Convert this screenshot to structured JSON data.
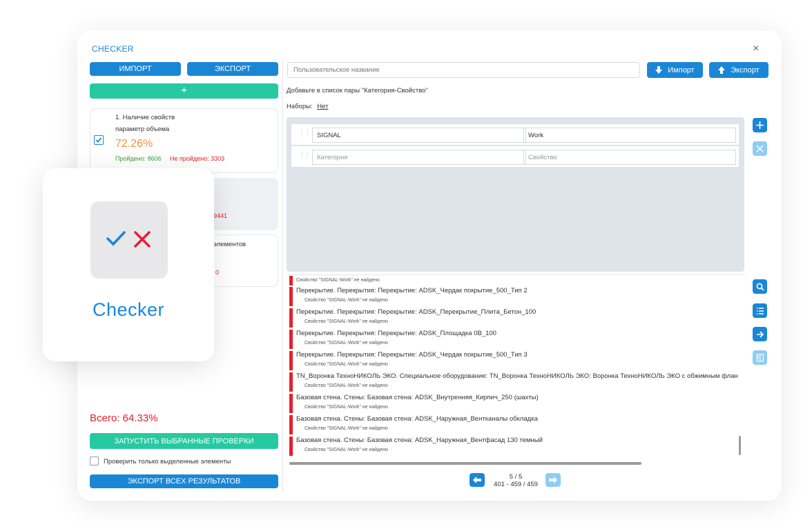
{
  "app": {
    "title": "CHECKER",
    "close": "×"
  },
  "left": {
    "import_label": "ИМПОРТ",
    "export_label": "ЭКСПОРТ",
    "add_label": "+",
    "check1": {
      "title_line1": "1. Наличие свойств",
      "title_line2": "параметр объема",
      "percent": "72.26%",
      "passed": "Пройдено: 8606",
      "failed": "Не пройдено: 3303",
      "checked": true
    },
    "check2": {
      "failed_tail": "9441"
    },
    "check3": {
      "title_tail": "элементов",
      "failed_tail": ": 0"
    },
    "total": "Всего: 64.33%",
    "run_label": "ЗАПУСТИТЬ ВЫБРАННЫЕ ПРОВЕРКИ",
    "only_selected_label": "Проверить только выделенные элементы",
    "export_all_label": "ЭКСПОРТ ВСЕХ РЕЗУЛЬТАТОВ"
  },
  "right": {
    "name_placeholder": "Пользовательское название",
    "import_label": "Импорт",
    "export_label": "Экспорт",
    "hint": "Добавьте в список пары \"Категория-Свойство\"",
    "sets_label": "Наборы:",
    "sets_value": "Нет",
    "pairs": [
      {
        "category": "SIGNAL",
        "property": "Work"
      }
    ],
    "new_pair": {
      "category_placeholder": "Категория",
      "property_placeholder": "Свойство"
    },
    "results_top_sub": "Свойство \"SIGNAL-Work\" не найдено",
    "results": [
      {
        "main": "Перекрытие. Перекрытия: Перекрытие: ADSK_Чердак покрытие_500_Тип 2",
        "sub": "Свойство \"SIGNAL-Work\" не найдено"
      },
      {
        "main": "Перекрытие. Перекрытия: Перекрытие: ADSK_Перекрытие_Плита_Бетон_100",
        "sub": "Свойство \"SIGNAL-Work\" не найдено"
      },
      {
        "main": "Перекрытие. Перекрытия: Перекрытие: ADSK_Площадка 0В_100",
        "sub": "Свойство \"SIGNAL-Work\" не найдено"
      },
      {
        "main": "Перекрытие. Перекрытия: Перекрытие: ADSK_Чердак покрытие_500_Тип 3",
        "sub": "Свойство \"SIGNAL-Work\" не найдено"
      },
      {
        "main": "TN_Воронка ТехноНИКОЛЬ ЭКО. Специальное оборудование: TN_Воронка ТехноНИКОЛЬ ЭКО: Воронка ТехноНИКОЛЬ ЭКО с обжимным флан",
        "sub": "Свойство \"SIGNAL-Work\" не найдено"
      },
      {
        "main": "Базовая стена. Стены: Базовая стена: ADSK_Внутренняя_Кирпич_250 (шахты)",
        "sub": "Свойство \"SIGNAL-Work\" не найдено"
      },
      {
        "main": "Базовая стена. Стены: Базовая стена: ADSK_Наружная_Вентканалы обкладка",
        "sub": "Свойство \"SIGNAL-Work\" не найдено"
      },
      {
        "main": "Базовая стена. Стены: Базовая стена: ADSK_Наружная_Вентфасад 130 темный",
        "sub": "Свойство \"SIGNAL-Work\" не найдено"
      }
    ],
    "pager": {
      "page": "5 / 5",
      "range": "401 - 459 / 459"
    }
  },
  "overlay": {
    "brand": "Checker"
  },
  "colors": {
    "accent_blue": "#1a87d6",
    "accent_green": "#26c9a1",
    "error_red": "#e5202a",
    "percent_orange": "#f5913a"
  },
  "icons": [
    "plus-icon",
    "close-icon",
    "search-icon",
    "list-icon",
    "arrow-right-icon",
    "columns-icon",
    "arrow-left-icon",
    "checkmark-icon",
    "cross-icon",
    "drag-handle-icon",
    "download-icon",
    "upload-icon"
  ]
}
